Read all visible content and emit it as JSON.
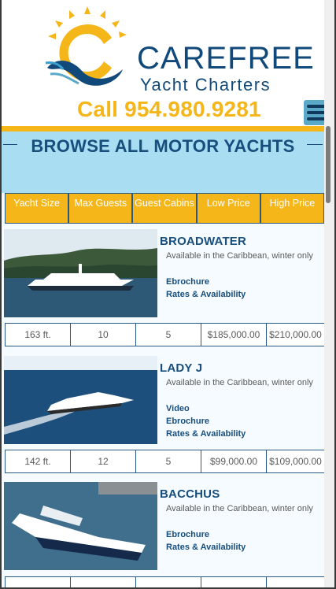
{
  "header": {
    "brand_line1": "CAREFREE",
    "brand_line2": "Yacht Charters",
    "phone": "Call 954.980.9281"
  },
  "browse_title": "BROWSE ALL MOTOR YACHTS",
  "columns": [
    "Yacht Size",
    "Max Guests",
    "Guest Cabins",
    "Low Price",
    "High Price"
  ],
  "yachts": [
    {
      "name": "BROADWATER",
      "availability": "Available in the Caribbean, winter only",
      "links": [
        "Ebrochure",
        "Rates & Availability"
      ],
      "size": "163 ft.",
      "guests": "10",
      "cabins": "5",
      "low": "$185,000.00",
      "high": "$210,000.00"
    },
    {
      "name": "LADY J",
      "availability": "Available in the Caribbean, winter only",
      "links": [
        "Video",
        "Ebrochure",
        "Rates & Availability"
      ],
      "size": "142 ft.",
      "guests": "12",
      "cabins": "5",
      "low": "$99,000.00",
      "high": "$109,000.00"
    },
    {
      "name": "BACCHUS",
      "availability": "Available in the Caribbean, winter only",
      "links": [
        "Ebrochure",
        "Rates & Availability"
      ]
    }
  ],
  "colors": {
    "navy": "#174e7d",
    "gold": "#f5b61a",
    "sky": "#a9def2"
  },
  "icons": [
    "sun-logo-icon",
    "hamburger-menu-icon"
  ]
}
